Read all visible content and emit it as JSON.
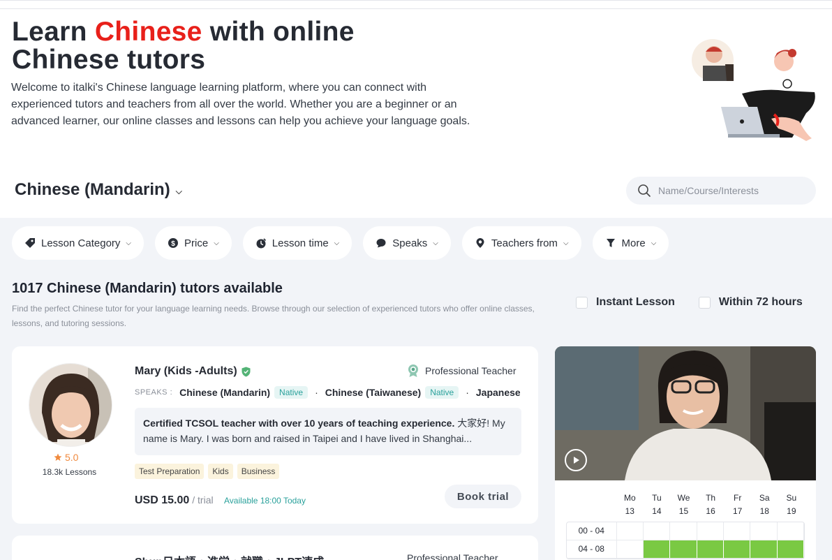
{
  "header": {
    "title_part1": "Learn ",
    "title_accent": "Chinese",
    "title_part2": " with online Chinese tutors",
    "intro": "Welcome to italki's Chinese language learning platform, where you can connect with experienced tutors and teachers from all over the world. Whether you are a beginner or an advanced learner, our online classes and lessons can help you achieve your language goals."
  },
  "language_selector": {
    "label": "Chinese (Mandarin)"
  },
  "search": {
    "placeholder": "Name/Course/Interests"
  },
  "filters": [
    {
      "label": "Lesson Category",
      "icon": "tag-icon"
    },
    {
      "label": "Price",
      "icon": "dollar-icon"
    },
    {
      "label": "Lesson time",
      "icon": "clock-icon"
    },
    {
      "label": "Speaks",
      "icon": "chat-icon"
    },
    {
      "label": "Teachers from",
      "icon": "location-icon"
    },
    {
      "label": "More",
      "icon": "funnel-icon"
    }
  ],
  "results": {
    "count_title": "1017 Chinese (Mandarin) tutors available",
    "description": "Find the perfect Chinese tutor for your language learning needs. Browse through our selection of experienced tutors who offer online classes, lessons, and tutoring sessions."
  },
  "toggles": {
    "instant": "Instant Lesson",
    "within72": "Within 72 hours"
  },
  "tutors": [
    {
      "name": "Mary (Kids -Adults)",
      "badge": "Professional Teacher",
      "rating": "5.0",
      "lessons": "18.3k Lessons",
      "speaks_label": "SPEAKS :",
      "languages": [
        {
          "name": "Chinese (Mandarin)",
          "level": "Native"
        },
        {
          "name": "Chinese (Taiwanese)",
          "level": "Native"
        },
        {
          "name": "Japanese",
          "level": ""
        }
      ],
      "about_bold": "Certified TCSOL teacher with over 10 years of teaching experience.",
      "about_rest": " 大家好! My name is Mary. I was born and raised in Taipei and I have lived in Shanghai...",
      "tags": [
        "Test Preparation",
        "Kids",
        "Business"
      ],
      "price": "USD 15.00",
      "price_unit": "/ trial",
      "available": "Available 18:00 Today",
      "book_label": "Book trial"
    },
    {
      "name": "Shun日本語・進学・就職・JLPT速成",
      "badge": "Professional Teacher"
    }
  ],
  "schedule": {
    "days": [
      {
        "dow": "Mo",
        "date": "13"
      },
      {
        "dow": "Tu",
        "date": "14"
      },
      {
        "dow": "We",
        "date": "15"
      },
      {
        "dow": "Th",
        "date": "16"
      },
      {
        "dow": "Fr",
        "date": "17"
      },
      {
        "dow": "Sa",
        "date": "18"
      },
      {
        "dow": "Su",
        "date": "19"
      }
    ],
    "slots": [
      {
        "label": "00 - 04",
        "available": [
          false,
          false,
          false,
          false,
          false,
          false,
          false
        ]
      },
      {
        "label": "04 - 08",
        "available": [
          false,
          true,
          true,
          true,
          true,
          true,
          true
        ]
      }
    ],
    "available_color": "#7ac943"
  },
  "colors": {
    "accent": "#e8201a",
    "teal": "#2aa19b",
    "rating": "#f08a3e"
  }
}
